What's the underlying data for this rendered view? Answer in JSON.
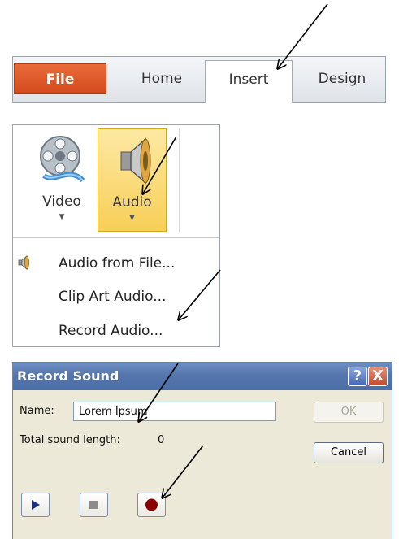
{
  "ribbon": {
    "tabs": [
      "File",
      "Home",
      "Insert",
      "Design"
    ],
    "active_tab": "Insert"
  },
  "media_group": {
    "buttons": [
      {
        "label": "Video",
        "icon": "film-reel-icon"
      },
      {
        "label": "Audio",
        "icon": "speaker-icon"
      }
    ],
    "selected_button": "Audio",
    "audio_menu": {
      "items": [
        {
          "label": "Audio from File...",
          "icon": "speaker-icon"
        },
        {
          "label": "Clip Art Audio..."
        },
        {
          "label": "Record Audio..."
        }
      ]
    }
  },
  "record_dialog": {
    "title": "Record Sound",
    "name_label": "Name:",
    "name_value": "Lorem Ipsum",
    "length_label": "Total sound length:",
    "length_value": "0",
    "ok_label": "OK",
    "cancel_label": "Cancel",
    "titlebar_buttons": [
      "?",
      "X"
    ],
    "controls": [
      {
        "icon": "play-icon",
        "color": "#1a2f8c"
      },
      {
        "icon": "stop-icon",
        "color": "#8c8c8c"
      },
      {
        "icon": "record-icon",
        "color": "#8b0000"
      }
    ]
  },
  "colors": {
    "file_tab": "#d8502a",
    "audio_highlight": "#f9d76f",
    "dialog_title": "#5b7cb4",
    "dialog_body": "#ece9d8",
    "arrow": "#000000"
  }
}
